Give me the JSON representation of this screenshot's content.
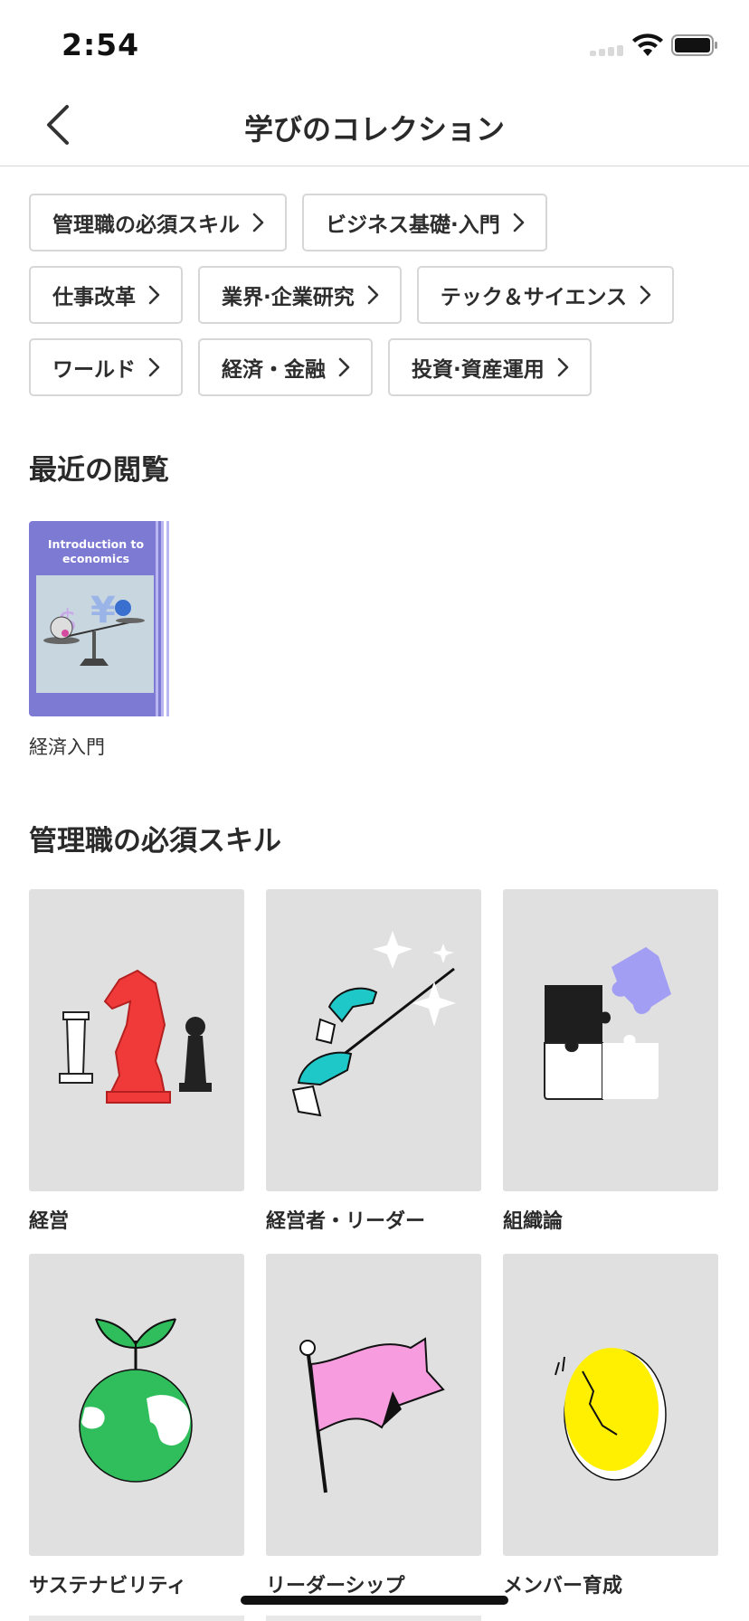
{
  "status_bar": {
    "time": "2:54"
  },
  "nav": {
    "title": "学びのコレクション"
  },
  "chips": [
    [
      "管理職の必須スキル",
      "ビジネス基礎·入門"
    ],
    [
      "仕事改革",
      "業界·企業研究",
      "テック＆サイエンス"
    ],
    [
      "ワールド",
      "経済・金融",
      "投資·資産運用"
    ]
  ],
  "recent": {
    "title": "最近の閲覧",
    "items": [
      {
        "label": "経済入門",
        "cover_title": "Introduction to economics",
        "cover_color": "#7d7ad3"
      }
    ]
  },
  "management": {
    "title": "管理職の必須スキル",
    "items": [
      {
        "label": "経営",
        "icon": "chess-pieces-icon"
      },
      {
        "label": "経営者・リーダー",
        "icon": "conductor-hands-icon"
      },
      {
        "label": "組織論",
        "icon": "puzzle-pieces-icon"
      },
      {
        "label": "サステナビリティ",
        "icon": "sprouting-globe-icon"
      },
      {
        "label": "リーダーシップ",
        "icon": "flag-icon"
      },
      {
        "label": "メンバー育成",
        "icon": "cracked-egg-icon"
      }
    ]
  },
  "colors": {
    "accent_purple": "#7d7ad3",
    "chess_red": "#f03a3a",
    "teal": "#1ec8c8",
    "green": "#2fbe5b",
    "pink": "#f79ddf",
    "yellow": "#ffef00"
  }
}
